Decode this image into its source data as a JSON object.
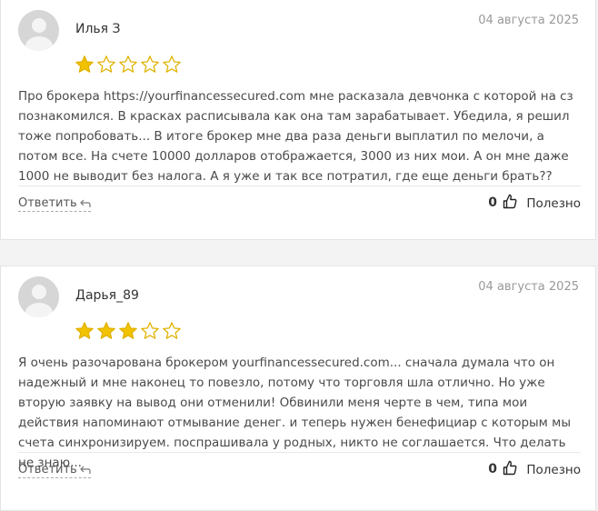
{
  "reviews": [
    {
      "author": "Илья З",
      "date": "04 августа 2025",
      "rating": 1,
      "max_rating": 5,
      "text": "Про брокера https://yourfinancessecured.com мне расказала девчонка с которой на сз познакомился. В красках расписывала как она там зарабатывает. Убедила, я решил тоже попробовать... В итоге брокер мне два раза деньги выплатил по мелочи, а потом все. На счете 10000 долларов отображается, 3000 из них мои. А он мне даже 1000 не выводит без налога. А я уже и так все потратил, где еще деньги брать??",
      "reply_label": "Ответить",
      "likes": "0",
      "useful_label": "Полезно"
    },
    {
      "author": "Дарья_89",
      "date": "04 августа 2025",
      "rating": 3,
      "max_rating": 5,
      "text": "Я очень разочарована брокером yourfinancessecured.com... сначала думала что он надежный и мне наконец то повезло, потому что торговля шла отлично. Но уже вторую заявку на вывод они отменили! Обвинили меня черте в чем, типа мои действия напоминают отмывание денег. и теперь нужен бенефициар с которым мы счета синхронизируем. поспрашивала у родных, никто не соглашается. Что делать не знаю...",
      "reply_label": "Ответить",
      "likes": "0",
      "useful_label": "Полезно"
    }
  ],
  "colors": {
    "star_filled": "#f2c200",
    "star_outline": "#e0b200",
    "avatar_bg": "#d6d6d6"
  },
  "icons": {
    "avatar": "user-silhouette-icon",
    "star": "star-icon",
    "reply": "reply-arrow-icon",
    "like": "thumbs-up-icon"
  }
}
